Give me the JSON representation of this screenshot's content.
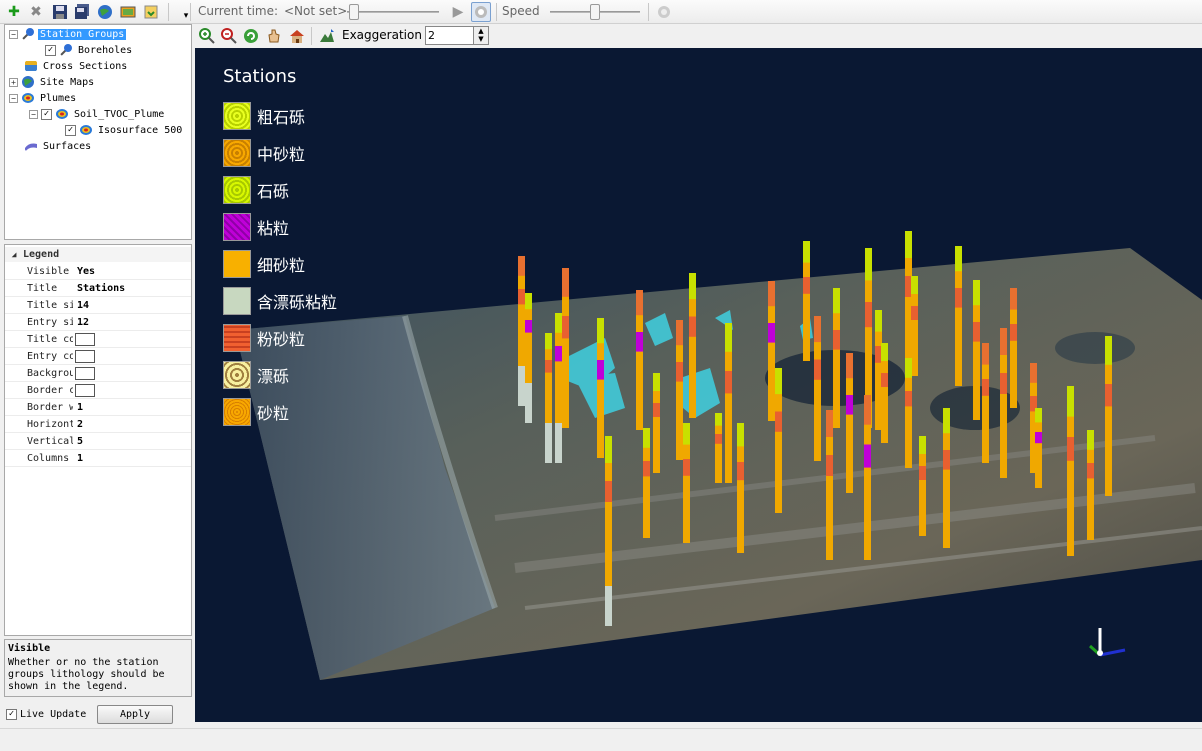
{
  "toolbar": {
    "current_time_label": "Current time:",
    "current_time_value": "<Not set>",
    "speed_label": "Speed"
  },
  "tree": {
    "items": [
      {
        "label": "Station Groups"
      },
      {
        "label": "Boreholes"
      },
      {
        "label": "Cross Sections"
      },
      {
        "label": "Site Maps"
      },
      {
        "label": "Plumes"
      },
      {
        "label": "Soil_TVOC_Plume"
      },
      {
        "label": "Isosurface 500"
      },
      {
        "label": "Surfaces"
      }
    ]
  },
  "properties": {
    "header": "Legend",
    "rows": [
      {
        "name": "Visible",
        "value": "Yes"
      },
      {
        "name": "Title",
        "value": "Stations"
      },
      {
        "name": "Title size",
        "value": "14"
      },
      {
        "name": "Entry size",
        "value": "12"
      },
      {
        "name": "Title color",
        "value": ""
      },
      {
        "name": "Entry color",
        "value": ""
      },
      {
        "name": "Background",
        "value": ""
      },
      {
        "name": "Border color",
        "value": ""
      },
      {
        "name": "Border width",
        "value": "1"
      },
      {
        "name": "Horizontal",
        "value": "2"
      },
      {
        "name": "Vertical",
        "value": "5"
      },
      {
        "name": "Columns",
        "value": "1"
      }
    ]
  },
  "description": {
    "title": "Visible",
    "text": "Whether or no the station groups lithology should be shown in the legend."
  },
  "bottom": {
    "live_update_label": "Live Update",
    "apply_label": "Apply"
  },
  "view_toolbar": {
    "exaggeration_label": "Exaggeration",
    "exaggeration_value": "2"
  },
  "legend": {
    "title": "Stations",
    "entries": [
      {
        "label": "粗石砾",
        "color": "#d8f000"
      },
      {
        "label": "中砂粒",
        "color": "#f0a000"
      },
      {
        "label": "石砾",
        "color": "#c8f000"
      },
      {
        "label": "粘粒",
        "color": "#c000d8"
      },
      {
        "label": "细砂粒",
        "color": "#f8b000"
      },
      {
        "label": "含漂砾粘粒",
        "color": "#c8d8c0"
      },
      {
        "label": "粉砂粒",
        "color": "#f06030"
      },
      {
        "label": "漂砾",
        "color": "#f8f0a0"
      },
      {
        "label": "砂粒",
        "color": "#f8a800"
      }
    ]
  }
}
